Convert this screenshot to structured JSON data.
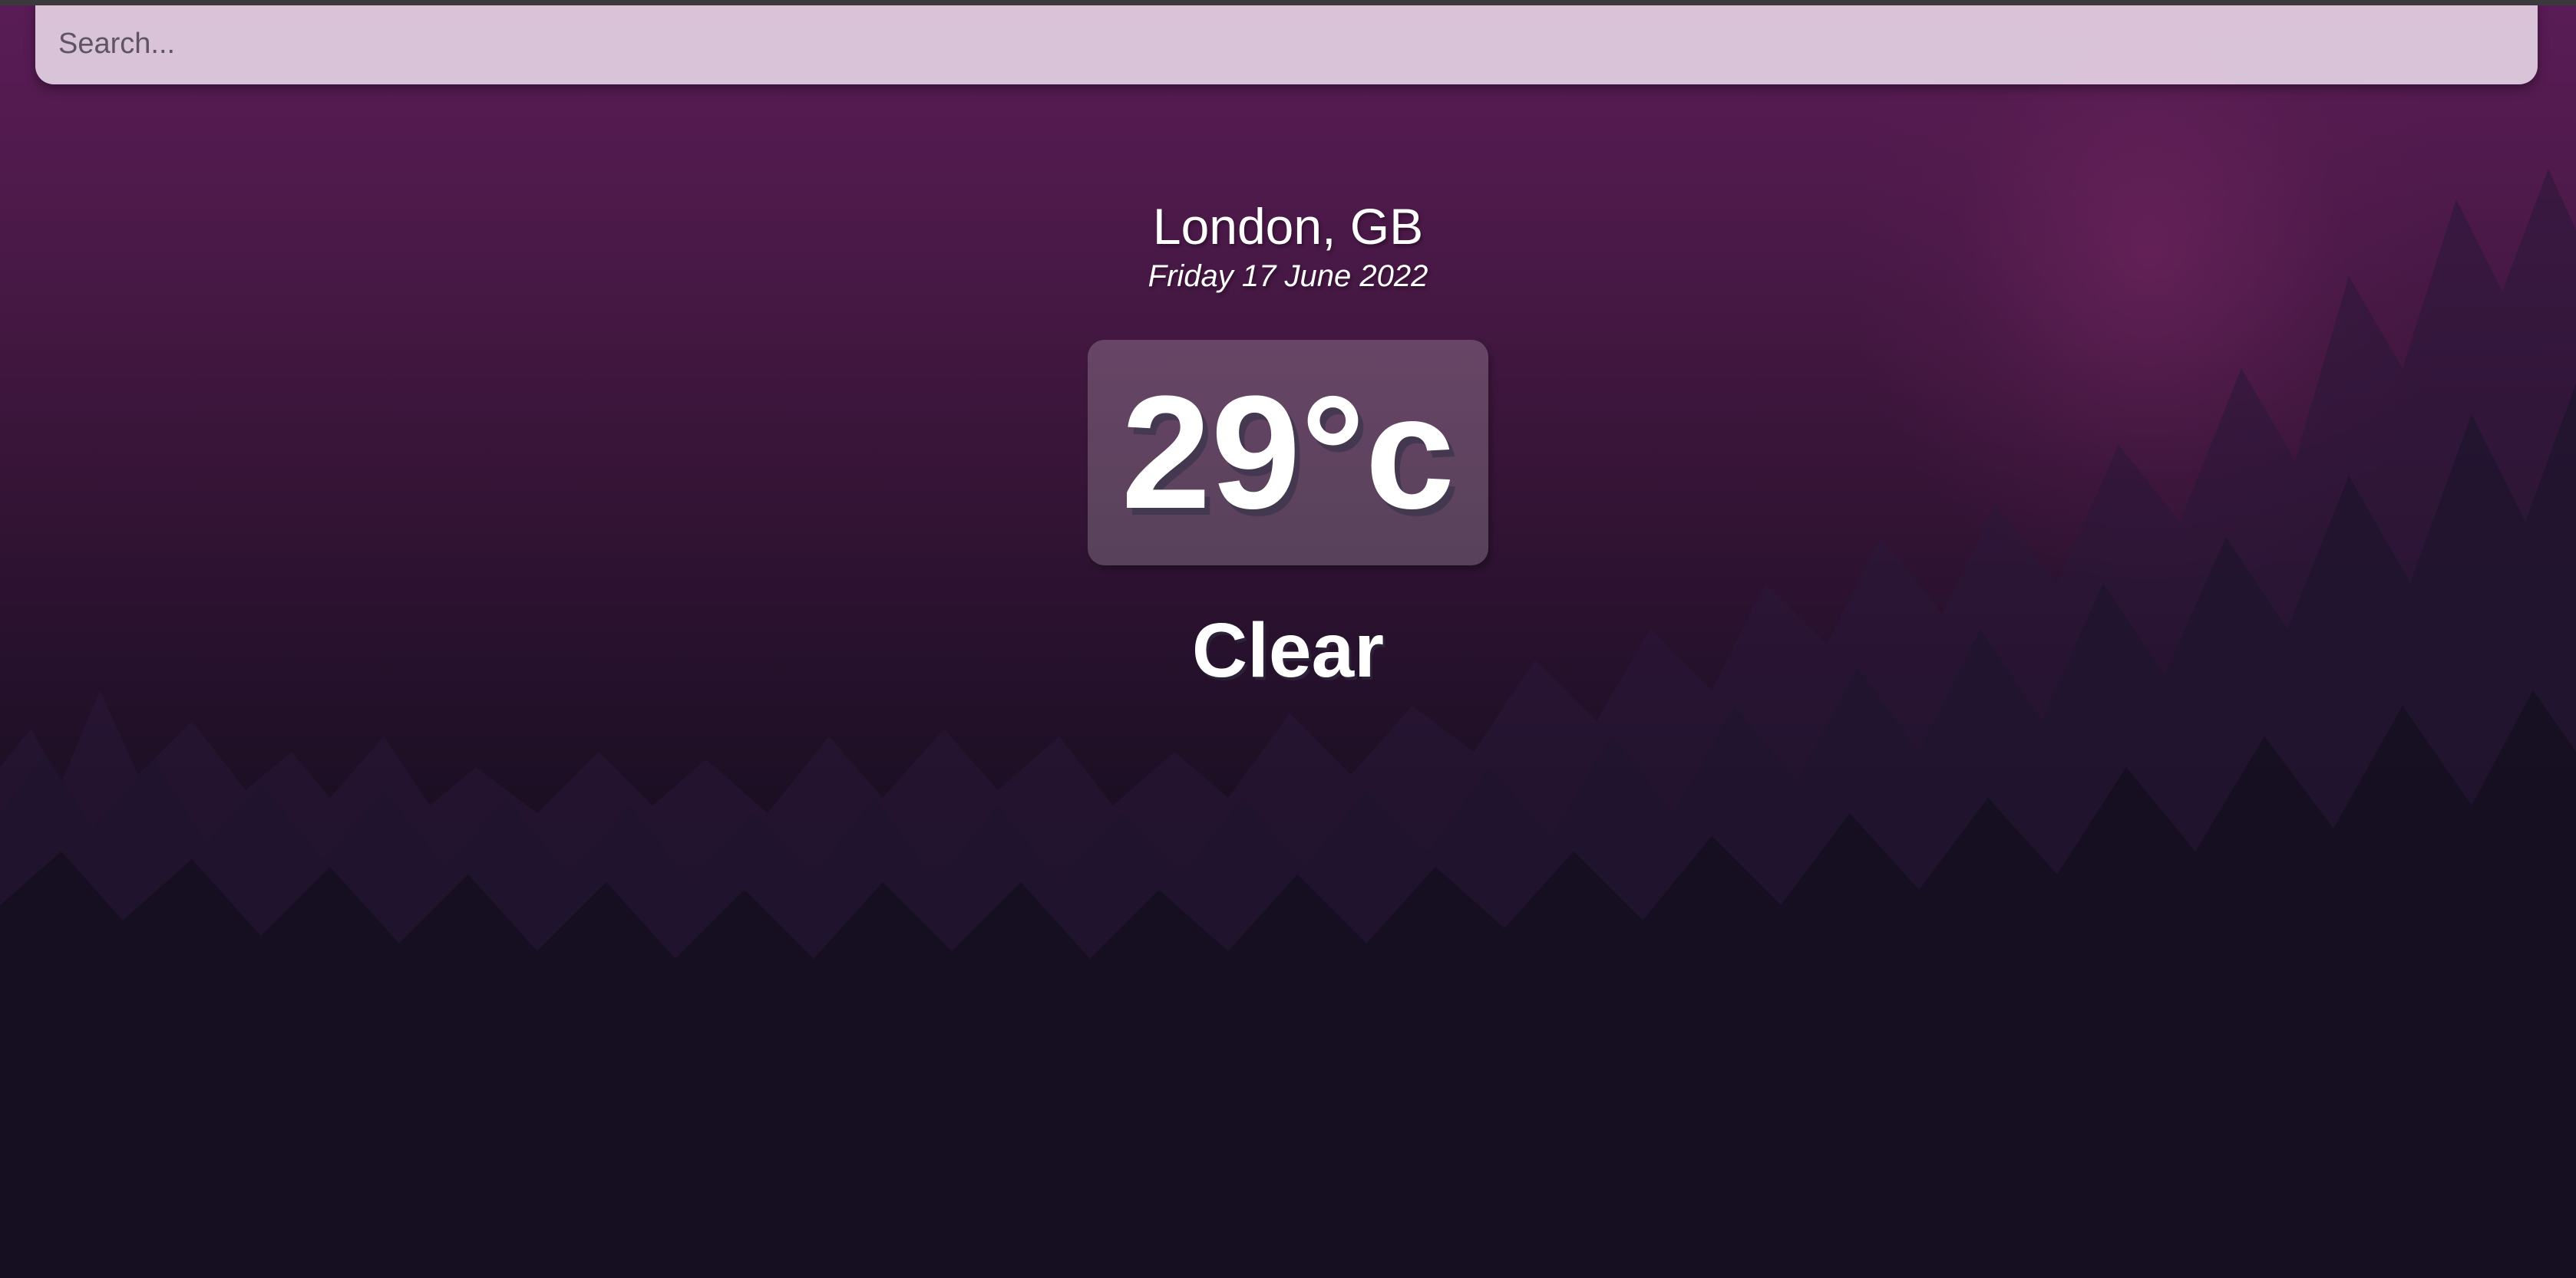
{
  "search": {
    "placeholder": "Search..."
  },
  "location": {
    "city_country": "London, GB",
    "date": "Friday 17 June 2022"
  },
  "weather": {
    "temperature": "29°c",
    "condition": "Clear"
  },
  "colors": {
    "background_top": "#5a1c56",
    "background_bottom": "#0d0a16",
    "search_bg": "#e8d6e8",
    "text": "#ffffff"
  },
  "background_icon": "forest-silhouette"
}
